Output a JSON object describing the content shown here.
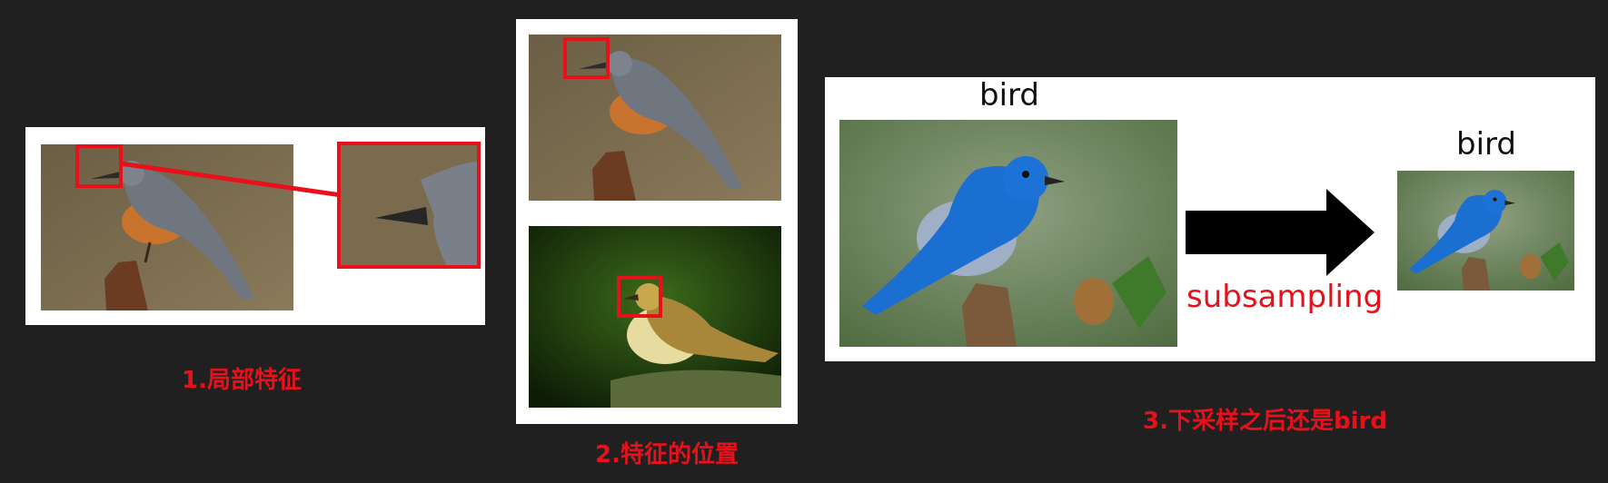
{
  "panel1": {
    "caption": "1.局部特征"
  },
  "panel2": {
    "caption": "2.特征的位置"
  },
  "panel3": {
    "caption": "3.下采样之后还是bird",
    "label_large": "bird",
    "label_small": "bird",
    "arrow_label": "subsampling"
  },
  "colors": {
    "background": "#202020",
    "highlight_red": "#e8101a",
    "panel_white": "#ffffff"
  }
}
